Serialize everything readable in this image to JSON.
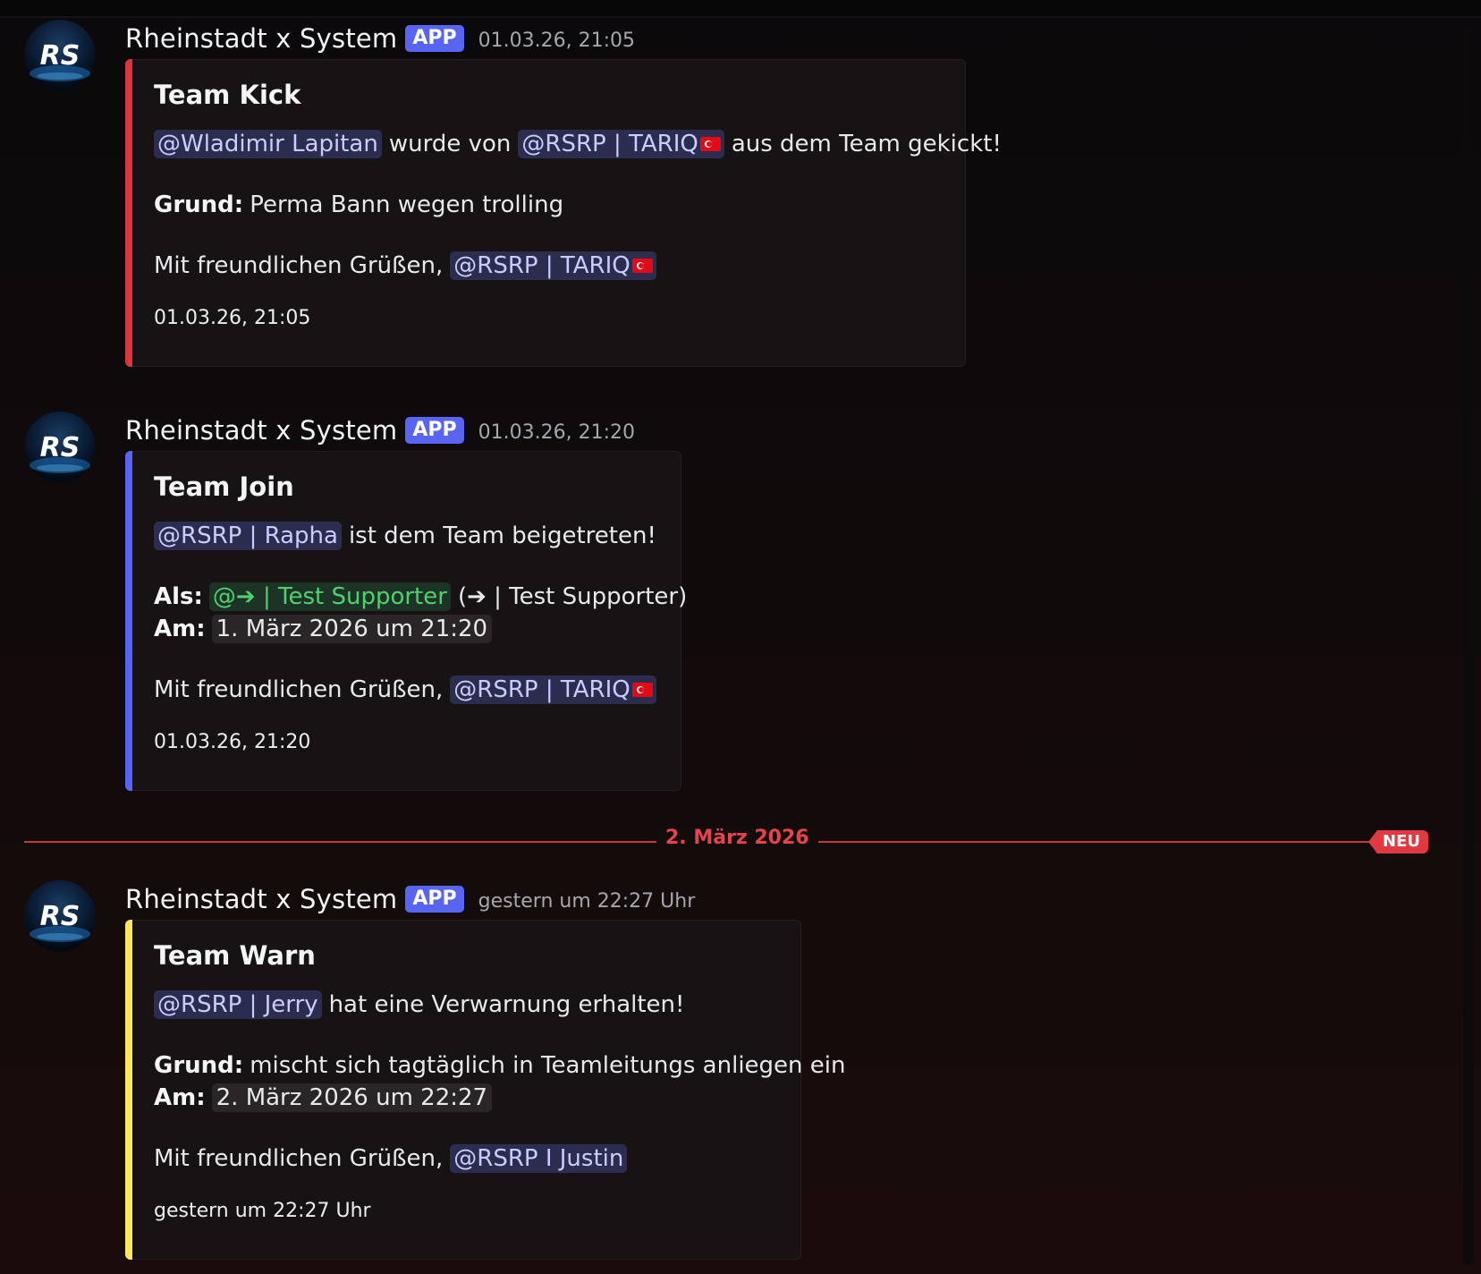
{
  "messages": [
    {
      "author": "Rheinstadt x System",
      "badge": "APP",
      "timestamp": "01.03.26, 21:05",
      "embed": {
        "accent_color": "#da373c",
        "title": "Team Kick",
        "mention_target": "@Wladimir Lapitan",
        "text_middle": "wurde von",
        "mention_actor": "@RSRP | TARIQ",
        "text_end": "aus dem Team gekickt!",
        "reason_label": "Grund:",
        "reason_text": "Perma Bann wegen trolling",
        "greeting": "Mit freundlichen Grüßen,",
        "signature_mention": "@RSRP | TARIQ",
        "footer": "01.03.26, 21:05"
      }
    },
    {
      "author": "Rheinstadt x System",
      "badge": "APP",
      "timestamp": "01.03.26, 21:20",
      "embed": {
        "accent_color": "#5865f2",
        "title": "Team Join",
        "mention_target": "@RSRP | Rapha",
        "text_end": "ist dem Team beigetreten!",
        "role_label": "Als:",
        "role_mention": "@➔ | Test Supporter",
        "role_plain": "(➔ | Test Supporter)",
        "date_label": "Am:",
        "date_value": "1. März 2026 um 21:20",
        "greeting": "Mit freundlichen Grüßen,",
        "signature_mention": "@RSRP | TARIQ",
        "footer": "01.03.26, 21:20"
      }
    },
    {
      "author": "Rheinstadt x System",
      "badge": "APP",
      "timestamp": "gestern um 22:27 Uhr",
      "embed": {
        "accent_color": "#fee75c",
        "title": "Team Warn",
        "mention_target": "@RSRP | Jerry",
        "text_end": "hat eine Verwarnung erhalten!",
        "reason_label": "Grund:",
        "reason_text": "mischt sich tagtäglich in Teamleitungs anliegen ein",
        "date_label": "Am:",
        "date_value": "2. März 2026 um 22:27",
        "greeting": "Mit freundlichen Grüßen,",
        "signature_mention": "@RSRP I Justin",
        "footer": "gestern um 22:27 Uhr"
      }
    }
  ],
  "divider": {
    "date": "2. März 2026",
    "badge": "NEU",
    "color": "#e0393f"
  },
  "icons": {
    "avatar": "rs-logo-avatar",
    "flag": "turkey-flag-icon"
  }
}
